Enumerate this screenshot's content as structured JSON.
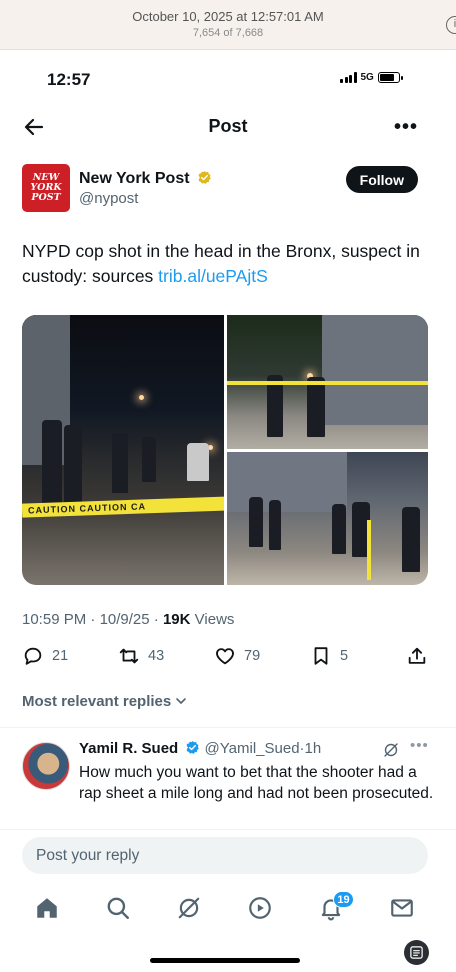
{
  "viewer": {
    "title": "October 10, 2025 at 12:57:01 AM",
    "count": "7,654 of 7,668",
    "info_icon": "info-icon"
  },
  "status_bar": {
    "time": "12:57",
    "network": "5G"
  },
  "nav": {
    "title": "Post",
    "back_icon": "arrow-left-icon",
    "more_icon": "more-horizontal-icon"
  },
  "author": {
    "avatar_text": [
      "NEW",
      "YORK",
      "POST"
    ],
    "name": "New York Post",
    "handle": "@nypost",
    "follow_label": "Follow",
    "verified_color": "#e2b719"
  },
  "tweet": {
    "text": "NYPD cop shot in the head in the Bronx, suspect in custody: sources ",
    "link": "trib.al/uePAjtS",
    "media_text": {
      "tape_1": "CAUTION      CAUTION      CA",
      "tape_2": ""
    }
  },
  "meta": {
    "time": "10:59 PM",
    "date": "10/9/25",
    "views_count": "19K",
    "views_label": "Views"
  },
  "actions": {
    "replies": "21",
    "reposts": "43",
    "likes": "79",
    "bookmarks": "5"
  },
  "replies_sort": {
    "label": "Most relevant replies"
  },
  "reply": {
    "name": "Yamil R. Sued",
    "handle": "@Yamil_Sued",
    "time": "1h",
    "text": "How much you want to bet that the shooter had a rap sheet a mile long and had not been prosecuted."
  },
  "compose": {
    "placeholder": "Post your reply"
  },
  "tabbar": {
    "notification_count": "19"
  },
  "colors": {
    "accent": "#1d9bf0",
    "text": "#0f1419",
    "muted": "#536471",
    "brand_red": "#cc1f26"
  }
}
